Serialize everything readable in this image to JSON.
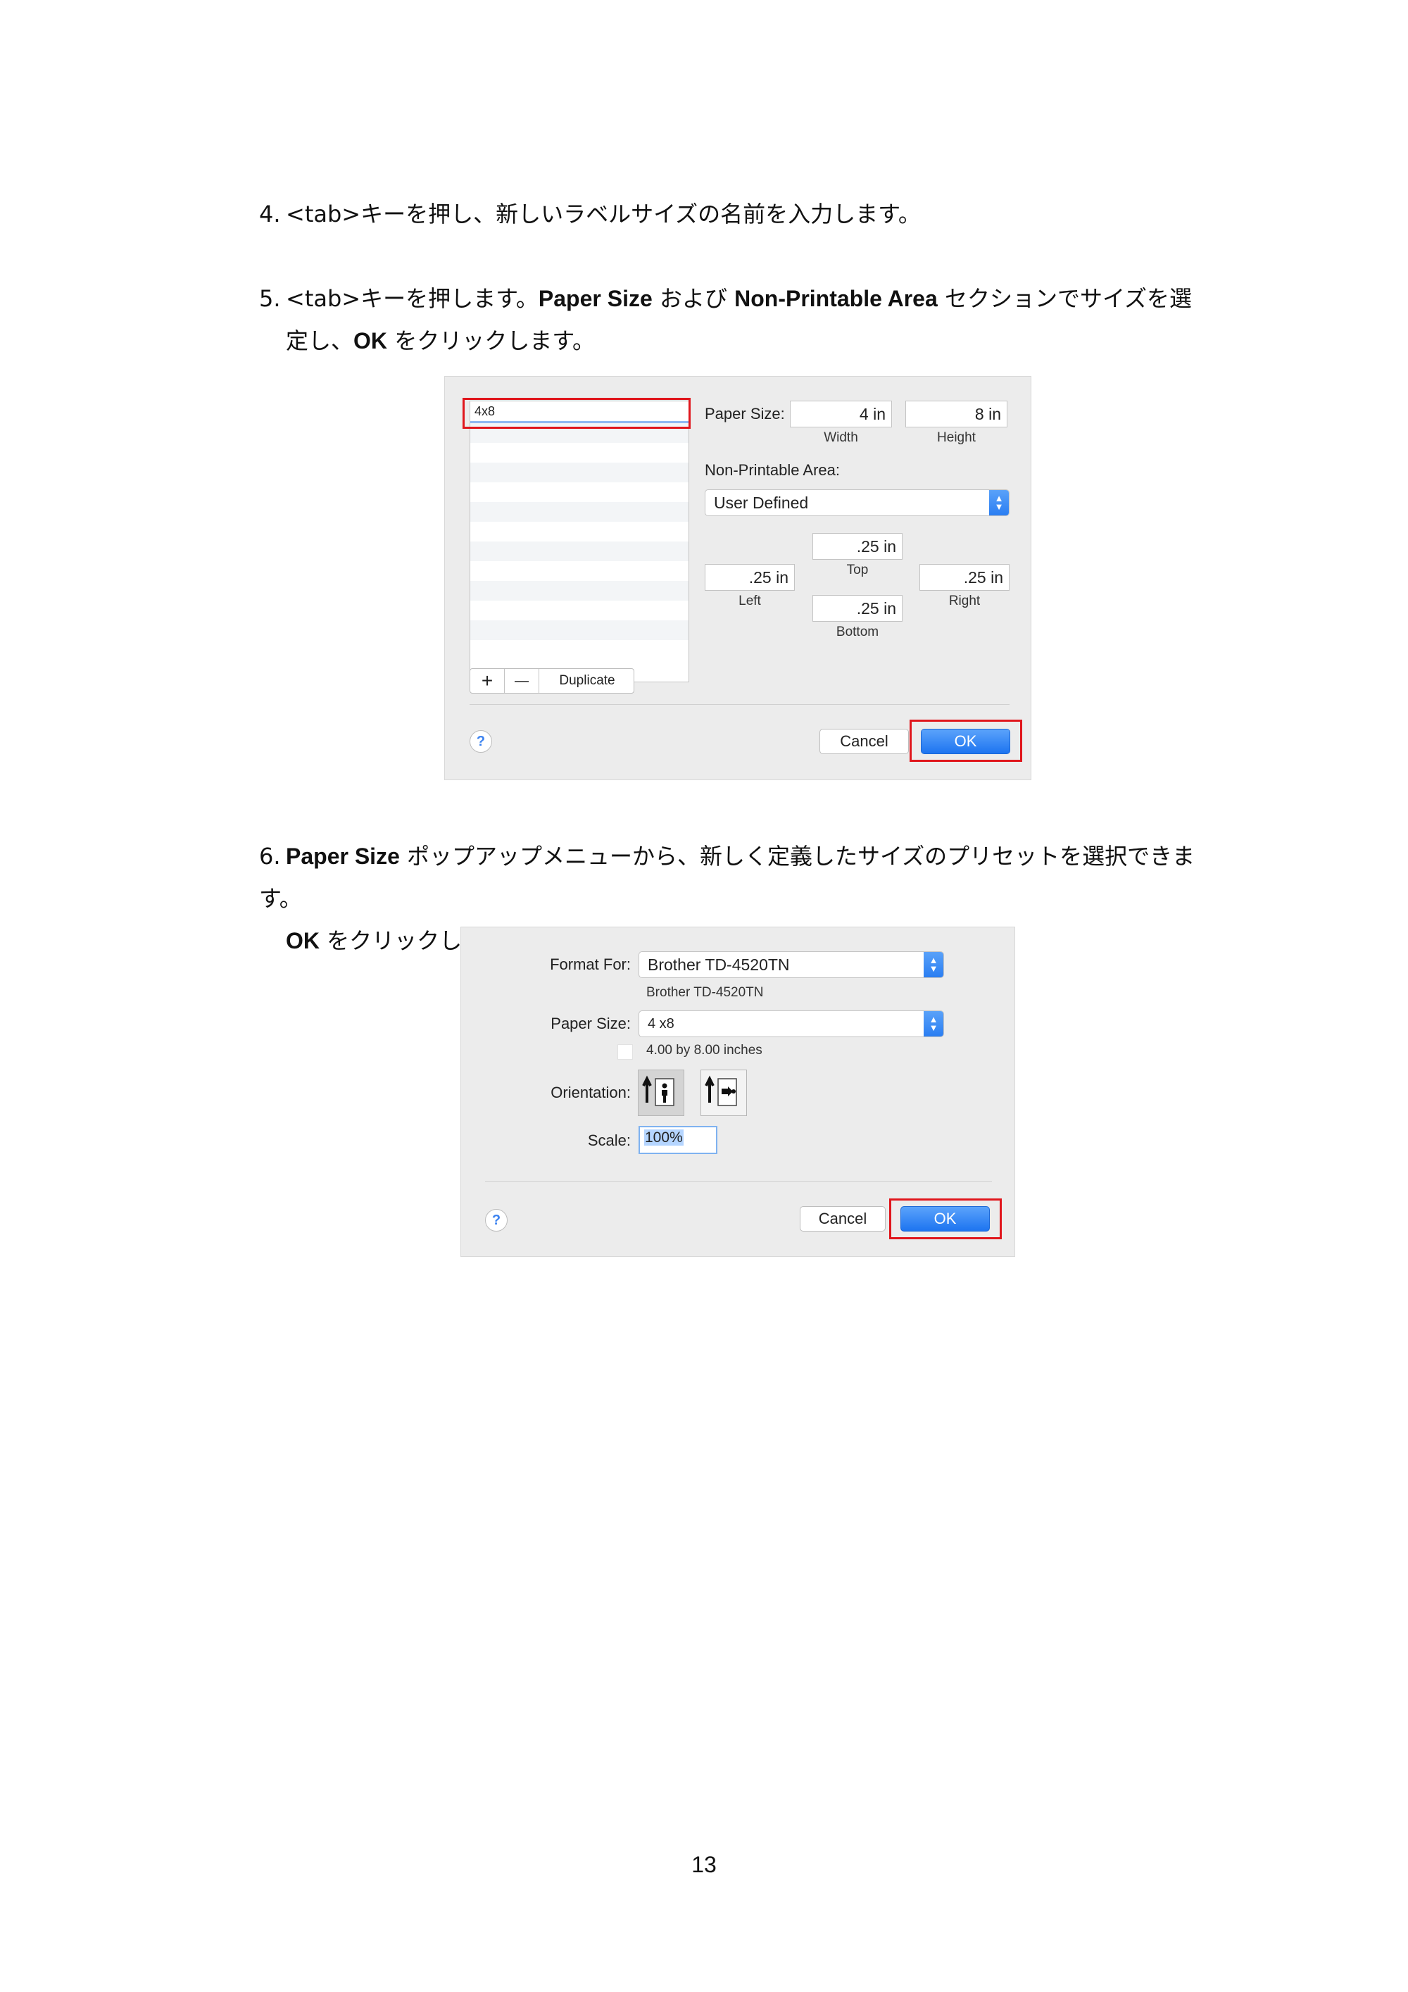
{
  "steps": {
    "step4": {
      "num": "4.",
      "text": "<tab>キーを押し、新しいラベルサイズの名前を入力します。"
    },
    "step5": {
      "num": "5.",
      "t1": "<tab>キーを押します。",
      "b1": "Paper Size",
      "t2": " および ",
      "b2": "Non-Printable Area",
      "t3": " セクションでサイズを選",
      "t4": "定し、",
      "b3": "OK",
      "t5": " をクリックします。"
    },
    "step6": {
      "num": "6.",
      "b1": "Paper Size",
      "t1": " ポップアップメニューから、新しく定義したサイズのプリセットを選択できます。",
      "b2": "OK",
      "t2": " をクリックします。"
    }
  },
  "dialog1": {
    "list_first_item": "4x8",
    "paper_size_label": "Paper Size:",
    "width_value": "4 in",
    "width_label": "Width",
    "height_value": "8 in",
    "height_label": "Height",
    "non_printable_label": "Non-Printable Area:",
    "non_printable_select": "User Defined",
    "top_value": ".25 in",
    "top_label": "Top",
    "left_value": ".25 in",
    "left_label": "Left",
    "right_value": ".25 in",
    "right_label": "Right",
    "bottom_value": ".25 in",
    "bottom_label": "Bottom",
    "add_symbol": "+",
    "remove_symbol": "—",
    "duplicate_label": "Duplicate",
    "help_symbol": "?",
    "cancel_label": "Cancel",
    "ok_label": "OK"
  },
  "dialog2": {
    "format_for_label": "Format For:",
    "format_for_value": "Brother TD-4520TN",
    "format_for_sub": "Brother TD-4520TN",
    "paper_size_label": "Paper Size:",
    "paper_size_value": "4 x8",
    "paper_size_sub": "4.00 by 8.00 inches",
    "orientation_label": "Orientation:",
    "scale_label": "Scale:",
    "scale_value": "100%",
    "help_symbol": "?",
    "cancel_label": "Cancel",
    "ok_label": "OK"
  },
  "page_number": "13"
}
